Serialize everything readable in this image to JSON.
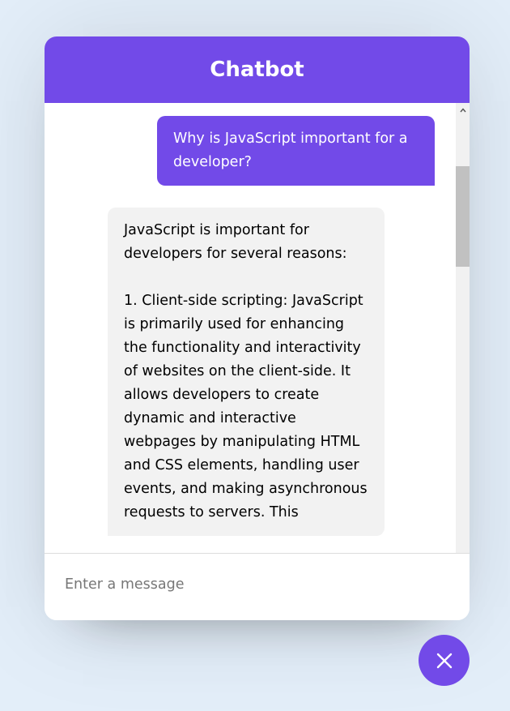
{
  "header": {
    "title": "Chatbot"
  },
  "messages": {
    "outgoing": "Why is JavaScript important for a developer?",
    "incoming": "JavaScript is important for developers for several reasons:\n\n1. Client-side scripting: JavaScript is primarily used for enhancing the functionality and interactivity of websites on the client-side. It allows developers to create dynamic and interactive webpages by manipulating HTML and CSS elements, handling user events, and making asynchronous requests to servers. This"
  },
  "input": {
    "placeholder": "Enter a message",
    "value": ""
  },
  "colors": {
    "accent": "#724ae8",
    "incoming_bg": "#f2f2f2",
    "page_bg": "#e3eef9"
  },
  "icons": {
    "toggler": "close-icon",
    "scroll_up": "chevron-up-icon"
  }
}
